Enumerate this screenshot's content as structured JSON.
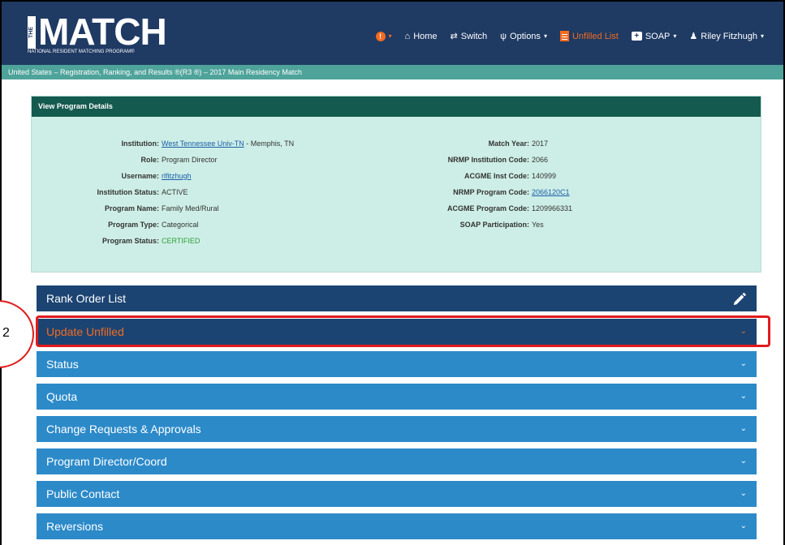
{
  "header": {
    "logo_the": "THE",
    "logo_word": "MATCH",
    "logo_sub": "NATIONAL RESIDENT MATCHING PROGRAM®",
    "nav": {
      "home": "Home",
      "switch": "Switch",
      "options": "Options",
      "unfilled": "Unfilled List",
      "soap": "SOAP",
      "user": "Riley Fitzhugh"
    }
  },
  "breadcrumb": "United States  –  Registration, Ranking, and Results ®(R3 ®)  –  2017 Main Residency Match",
  "details": {
    "title": "View Program Details",
    "left": [
      {
        "label": "Institution:",
        "value": "West Tennessee Univ-TN",
        "suffix": " - Memphis, TN"
      },
      {
        "label": "Role:",
        "value": "Program Director"
      },
      {
        "label": "Username:",
        "value": "rlfitzhugh"
      },
      {
        "label": "Institution Status:",
        "value": "ACTIVE"
      },
      {
        "label": "Program Name:",
        "value": "Family Med/Rural"
      },
      {
        "label": "Program Type:",
        "value": "Categorical"
      },
      {
        "label": "Program Status:",
        "value": "CERTIFIED"
      }
    ],
    "right": [
      {
        "label": "Match Year:",
        "value": "2017"
      },
      {
        "label": "NRMP Institution Code:",
        "value": "2066"
      },
      {
        "label": "ACGME Inst Code:",
        "value": "140999"
      },
      {
        "label": "NRMP Program Code:",
        "value": "2066120C1"
      },
      {
        "label": "ACGME Program Code:",
        "value": "1209966331"
      },
      {
        "label": "SOAP Participation:",
        "value": "Yes"
      }
    ]
  },
  "sections": [
    "Rank Order List",
    "Update Unfilled",
    "Status",
    "Quota",
    "Change Requests & Approvals",
    "Program Director/Coord",
    "Public Contact",
    "Reversions"
  ],
  "annotation": {
    "step": "2"
  },
  "colors": {
    "navy": "#1f3a63",
    "teal": "#4ea39a",
    "orange": "#f26b21",
    "highlight": "#e01b1b"
  }
}
